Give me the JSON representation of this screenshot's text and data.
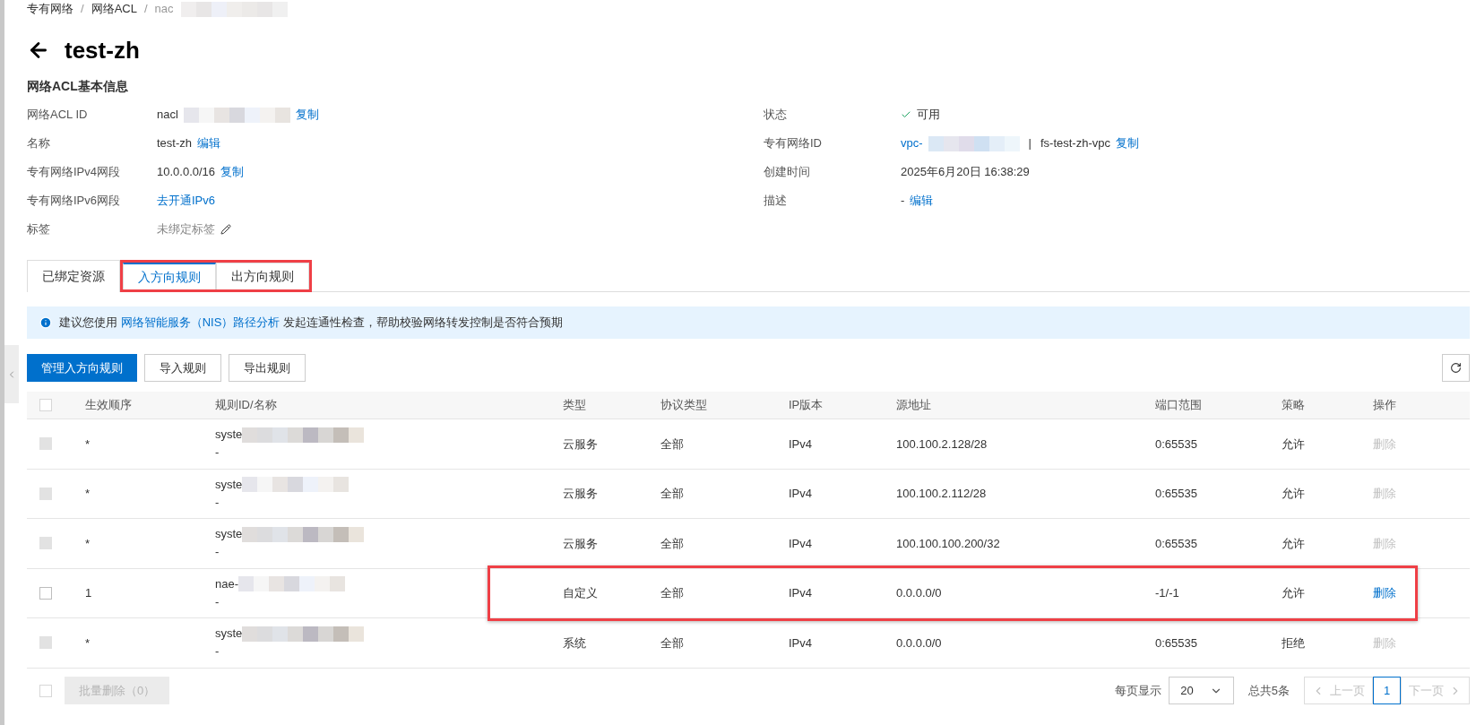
{
  "breadcrumb": [
    "专有网络",
    "网络ACL",
    "nac"
  ],
  "breadcrumb_separator": "/",
  "title": "test-zh",
  "section_title": "网络ACL基本信息",
  "info_left": [
    {
      "label": "网络ACL ID",
      "kind": "redacted",
      "value": "nacl",
      "links": [
        "复制"
      ]
    },
    {
      "label": "名称",
      "value": "test-zh",
      "links": [
        "编辑"
      ]
    },
    {
      "label": "专有网络IPv4网段",
      "value": "10.0.0.0/16",
      "links": [
        "复制"
      ]
    },
    {
      "label": "专有网络IPv6网段",
      "links": [
        "去开通IPv6"
      ]
    },
    {
      "label": "标签",
      "kind": "tags",
      "value": "未绑定标签"
    }
  ],
  "info_right": [
    {
      "label": "状态",
      "kind": "status",
      "value": "可用"
    },
    {
      "label": "专有网络ID",
      "kind": "vpc",
      "link_value": "vpc-",
      "separator": "|",
      "value": "fs-test-zh-vpc",
      "links": [
        "复制"
      ]
    },
    {
      "label": "创建时间",
      "value": "2025年6月20日 16:38:29"
    },
    {
      "label": "描述",
      "value": "-",
      "links": [
        "编辑"
      ]
    }
  ],
  "tabs": [
    {
      "label": "已绑定资源",
      "selected": false,
      "highlighted": false
    },
    {
      "label": "入方向规则",
      "selected": true,
      "highlighted": true
    },
    {
      "label": "出方向规则",
      "selected": false,
      "highlighted": true
    }
  ],
  "notice": {
    "before": "建议您使用",
    "link": "网络智能服务（NIS）路径分析",
    "after": "发起连通性检查，帮助校验网络转发控制是否符合预期"
  },
  "toolbar": [
    {
      "label": "管理入方向规则",
      "primary": true
    },
    {
      "label": "导入规则",
      "primary": false
    },
    {
      "label": "导出规则",
      "primary": false
    }
  ],
  "table": {
    "header_checked": false,
    "columns": [
      "生效顺序",
      "规则ID/名称",
      "类型",
      "协议类型",
      "IP版本",
      "源地址",
      "端口范围",
      "策略",
      "操作"
    ],
    "rows": [
      {
        "disabled": true,
        "order": "*",
        "rule_id": "syste",
        "name": "-",
        "type": "云服务",
        "protocol": "全部",
        "ip_version": "IPv4",
        "source": "100.100.2.128/28",
        "ports": "0:65535",
        "policy": "允许",
        "action": "删除",
        "highlighted": false
      },
      {
        "disabled": true,
        "order": "*",
        "rule_id": "syste",
        "name": "-",
        "type": "云服务",
        "protocol": "全部",
        "ip_version": "IPv4",
        "source": "100.100.2.112/28",
        "ports": "0:65535",
        "policy": "允许",
        "action": "删除",
        "highlighted": false
      },
      {
        "disabled": true,
        "order": "*",
        "rule_id": "syste",
        "name": "-",
        "type": "云服务",
        "protocol": "全部",
        "ip_version": "IPv4",
        "source": "100.100.100.200/32",
        "ports": "0:65535",
        "policy": "允许",
        "action": "删除",
        "highlighted": false
      },
      {
        "disabled": false,
        "order": "1",
        "rule_id": "nae-",
        "name": "-",
        "type": "自定义",
        "protocol": "全部",
        "ip_version": "IPv4",
        "source": "0.0.0.0/0",
        "ports": "-1/-1",
        "policy": "允许",
        "action": "删除",
        "highlighted": true
      },
      {
        "disabled": true,
        "order": "*",
        "rule_id": "syste",
        "name": "-",
        "type": "系统",
        "protocol": "全部",
        "ip_version": "IPv4",
        "source": "0.0.0.0/0",
        "ports": "0:65535",
        "policy": "拒绝",
        "action": "删除",
        "highlighted": false
      }
    ]
  },
  "footer": {
    "checked": false,
    "bulk_delete": "批量删除（0）",
    "page_size_label": "每页显示",
    "page_size": "20",
    "total": "总共5条",
    "prev": "上一页",
    "page": "1",
    "next": "下一页"
  }
}
